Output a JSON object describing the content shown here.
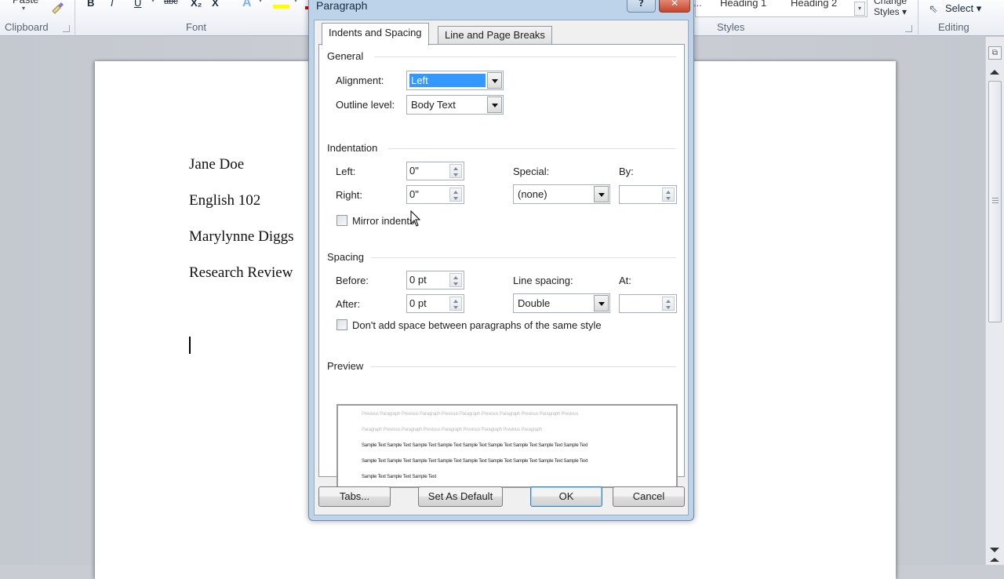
{
  "ribbon": {
    "paste_label": "Paste",
    "groups": {
      "clipboard": "Clipboard",
      "font": "Font",
      "styles": "Styles",
      "editing": "Editing"
    },
    "font_buttons": [
      "B",
      "I",
      "U",
      "abc",
      "X₂",
      "X"
    ],
    "styles_gallery": [
      "...",
      "Heading 1",
      "Heading 2"
    ],
    "change_styles_label": "Change Styles",
    "change_styles_line1": "Change",
    "change_styles_line2": "Styles ▾",
    "select_label": "Select ▾",
    "highlight_color": "#ffff00",
    "font_color": "#e00000"
  },
  "document": {
    "lines": [
      "Jane Doe",
      "English 102",
      "Marylynne Diggs",
      "Research Review"
    ]
  },
  "dialog": {
    "title": "Paragraph",
    "help_label": "?",
    "close_label": "✕",
    "tabs": [
      {
        "label": "Indents and Spacing",
        "active": true
      },
      {
        "label": "Line and Page Breaks",
        "active": false
      }
    ],
    "general": {
      "heading": "General",
      "alignment_label": "Alignment:",
      "alignment_value": "Left",
      "outline_label": "Outline level:",
      "outline_value": "Body Text"
    },
    "indentation": {
      "heading": "Indentation",
      "left_label": "Left:",
      "left_value": "0\"",
      "right_label": "Right:",
      "right_value": "0\"",
      "special_label": "Special:",
      "special_value": "(none)",
      "by_label": "By:",
      "by_value": "",
      "mirror_label": "Mirror indents",
      "mirror_checked": false
    },
    "spacing": {
      "heading": "Spacing",
      "before_label": "Before:",
      "before_value": "0 pt",
      "after_label": "After:",
      "after_value": "0 pt",
      "line_spacing_label": "Line spacing:",
      "line_spacing_value": "Double",
      "at_label": "At:",
      "at_value": "",
      "dont_add_label": "Don't add space between paragraphs of the same style",
      "dont_add_checked": false
    },
    "preview": {
      "heading": "Preview",
      "prev_lines": [
        "Previous Paragraph Previous Paragraph Previous Paragraph Previous Paragraph Previous Paragraph Previous",
        "Paragraph Previous Paragraph Previous Paragraph Previous Paragraph Previous Paragraph"
      ],
      "sample_lines": [
        "Sample Text Sample Text Sample Text Sample Text Sample Text Sample Text Sample Text Sample Text Sample Text",
        "Sample Text Sample Text Sample Text Sample Text Sample Text Sample Text Sample Text Sample Text Sample Text",
        "Sample Text Sample Text Sample Text"
      ]
    },
    "buttons": {
      "tabs": "Tabs...",
      "set_default": "Set As Default",
      "ok": "OK",
      "cancel": "Cancel"
    }
  }
}
